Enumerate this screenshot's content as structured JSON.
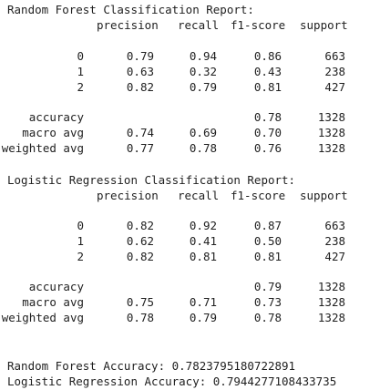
{
  "reports": [
    {
      "title": "Random Forest Classification Report:",
      "headers": {
        "precision": "precision",
        "recall": "recall",
        "f1": "f1-score",
        "support": "support"
      },
      "classes": [
        {
          "label": "0",
          "precision": "0.79",
          "recall": "0.94",
          "f1": "0.86",
          "support": "663"
        },
        {
          "label": "1",
          "precision": "0.63",
          "recall": "0.32",
          "f1": "0.43",
          "support": "238"
        },
        {
          "label": "2",
          "precision": "0.82",
          "recall": "0.79",
          "f1": "0.81",
          "support": "427"
        }
      ],
      "summary": [
        {
          "label": "accuracy",
          "precision": "",
          "recall": "",
          "f1": "0.78",
          "support": "1328"
        },
        {
          "label": "macro avg",
          "precision": "0.74",
          "recall": "0.69",
          "f1": "0.70",
          "support": "1328"
        },
        {
          "label": "weighted avg",
          "precision": "0.77",
          "recall": "0.78",
          "f1": "0.76",
          "support": "1328"
        }
      ]
    },
    {
      "title": "Logistic Regression Classification Report:",
      "headers": {
        "precision": "precision",
        "recall": "recall",
        "f1": "f1-score",
        "support": "support"
      },
      "classes": [
        {
          "label": "0",
          "precision": "0.82",
          "recall": "0.92",
          "f1": "0.87",
          "support": "663"
        },
        {
          "label": "1",
          "precision": "0.62",
          "recall": "0.41",
          "f1": "0.50",
          "support": "238"
        },
        {
          "label": "2",
          "precision": "0.82",
          "recall": "0.81",
          "f1": "0.81",
          "support": "427"
        }
      ],
      "summary": [
        {
          "label": "accuracy",
          "precision": "",
          "recall": "",
          "f1": "0.79",
          "support": "1328"
        },
        {
          "label": "macro avg",
          "precision": "0.75",
          "recall": "0.71",
          "f1": "0.73",
          "support": "1328"
        },
        {
          "label": "weighted avg",
          "precision": "0.78",
          "recall": "0.79",
          "f1": "0.78",
          "support": "1328"
        }
      ]
    }
  ],
  "accuracy_lines": {
    "random_forest": "Random Forest Accuracy: 0.7823795180722891",
    "logistic_regression": "Logistic Regression Accuracy: 0.7944277108433735"
  }
}
